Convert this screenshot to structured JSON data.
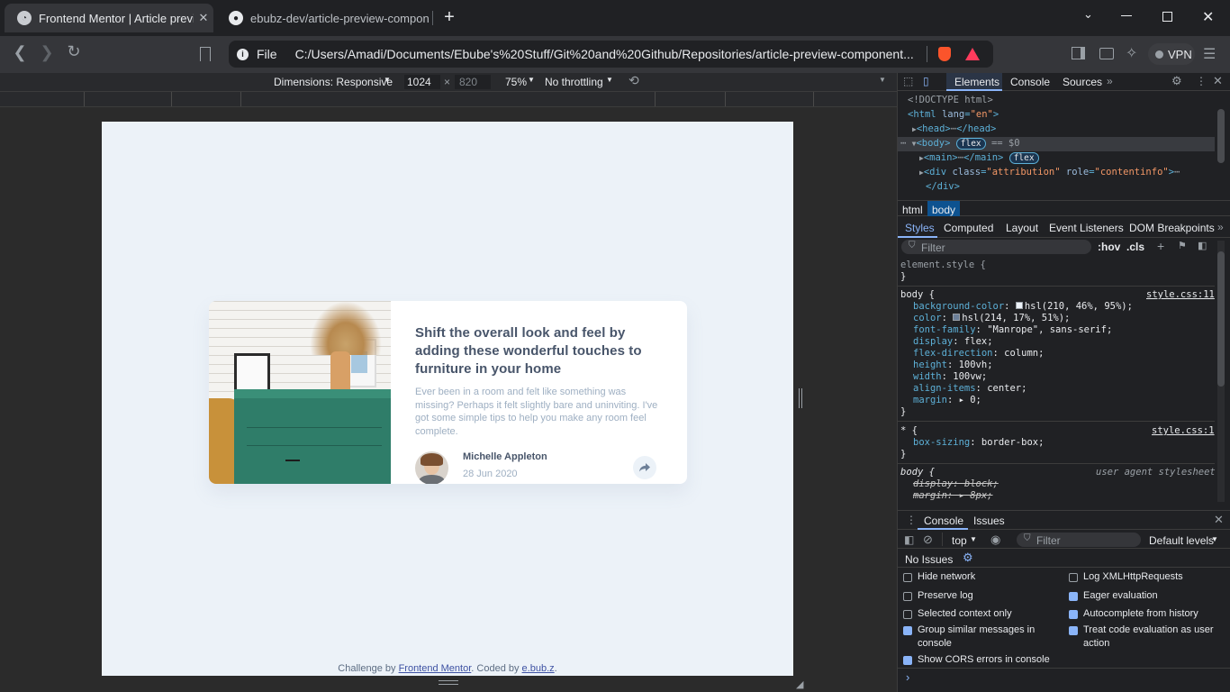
{
  "tabs": [
    {
      "title": "Frontend Mentor | Article previ",
      "close": "✕",
      "active": true
    },
    {
      "title": "ebubz-dev/article-preview-compon",
      "close": "✕",
      "active": false
    }
  ],
  "new_tab": "+",
  "omnibox": {
    "scheme": "File",
    "url": "C:/Users/Amadi/Documents/Ebube's%20Stuff/Git%20and%20Github/Repositories/article-preview-component..."
  },
  "vpn_label": "VPN",
  "device_toolbar": {
    "dimensions": "Dimensions: Responsive",
    "width": "1024",
    "times": "×",
    "height": "820",
    "zoom": "75%",
    "throttling": "No throttling"
  },
  "card": {
    "title": "Shift the overall look and feel by adding these wonderful touches to furniture in your home",
    "text": "Ever been in a room and felt like something was missing? Perhaps it felt slightly bare and uninviting. I've got some simple tips to help you make any room feel complete.",
    "author": "Michelle Appleton",
    "date": "28 Jun 2020"
  },
  "attribution": {
    "prefix": "Challenge by ",
    "link1": "Frontend Mentor",
    "middle": ". Coded by ",
    "link2": "e.bub.z",
    "suffix": "."
  },
  "devtools": {
    "tabs": [
      "Elements",
      "Console",
      "Sources"
    ],
    "dom": {
      "doctype": "<!DOCTYPE html>",
      "html_open": "<html",
      "lang_attr": "lang",
      "lang_val": "\"en\"",
      "head": "<head>",
      "head_close": "</head>",
      "body": "<body>",
      "flex_badge": "flex",
      "eq": "== $0",
      "main": "<main>",
      "main_close": "</main>",
      "div_open": "<div",
      "class_attr": "class",
      "class_val": "\"attribution\"",
      "role_attr": "role",
      "role_val": "\"contentinfo\"",
      "div_close": "</div>"
    },
    "breadcrumbs": [
      "html",
      "body"
    ],
    "subtabs": [
      "Styles",
      "Computed",
      "Layout",
      "Event Listeners",
      "DOM Breakpoints"
    ],
    "filter_placeholder": "Filter",
    "hov": ":hov",
    "cls": ".cls",
    "styles": {
      "element_style": "element.style {",
      "close": "}",
      "body_sel": "body {",
      "body_src": "style.css:11",
      "props": [
        {
          "name": "background-color",
          "value": "hsl(210, 46%, 95%);",
          "swatch": "#ecf2f8"
        },
        {
          "name": "color",
          "value": "hsl(214, 17%, 51%);",
          "swatch": "#6c7f99"
        },
        {
          "name": "font-family",
          "value": "\"Manrope\", sans-serif;"
        },
        {
          "name": "display",
          "value": "flex;"
        },
        {
          "name": "flex-direction",
          "value": "column;"
        },
        {
          "name": "height",
          "value": "100vh;"
        },
        {
          "name": "width",
          "value": "100vw;"
        },
        {
          "name": "align-items",
          "value": "center;"
        },
        {
          "name": "margin",
          "value": "▸ 0;"
        }
      ],
      "star_sel": "* {",
      "star_src": "style.css:1",
      "star_prop": "box-sizing",
      "star_val": "border-box;",
      "ua_sel": "body {",
      "ua_src": "user agent stylesheet",
      "ua_p1": "display: block;",
      "ua_p2": "margin: ▸ 8px;"
    },
    "drawer": {
      "tabs": [
        "Console",
        "Issues"
      ],
      "context": "top",
      "filter_placeholder": "Filter",
      "levels": "Default levels",
      "no_issues": "No Issues",
      "options_left": [
        {
          "label": "Hide network",
          "checked": false
        },
        {
          "label": "Preserve log",
          "checked": false
        },
        {
          "label": "Selected context only",
          "checked": false
        },
        {
          "label": "Group similar messages in console",
          "checked": true
        },
        {
          "label": "Show CORS errors in console",
          "checked": true
        }
      ],
      "options_right": [
        {
          "label": "Log XMLHttpRequests",
          "checked": false
        },
        {
          "label": "Eager evaluation",
          "checked": true
        },
        {
          "label": "Autocomplete from history",
          "checked": true
        },
        {
          "label": "Treat code evaluation as user action",
          "checked": true
        }
      ],
      "prompt": "›"
    }
  }
}
